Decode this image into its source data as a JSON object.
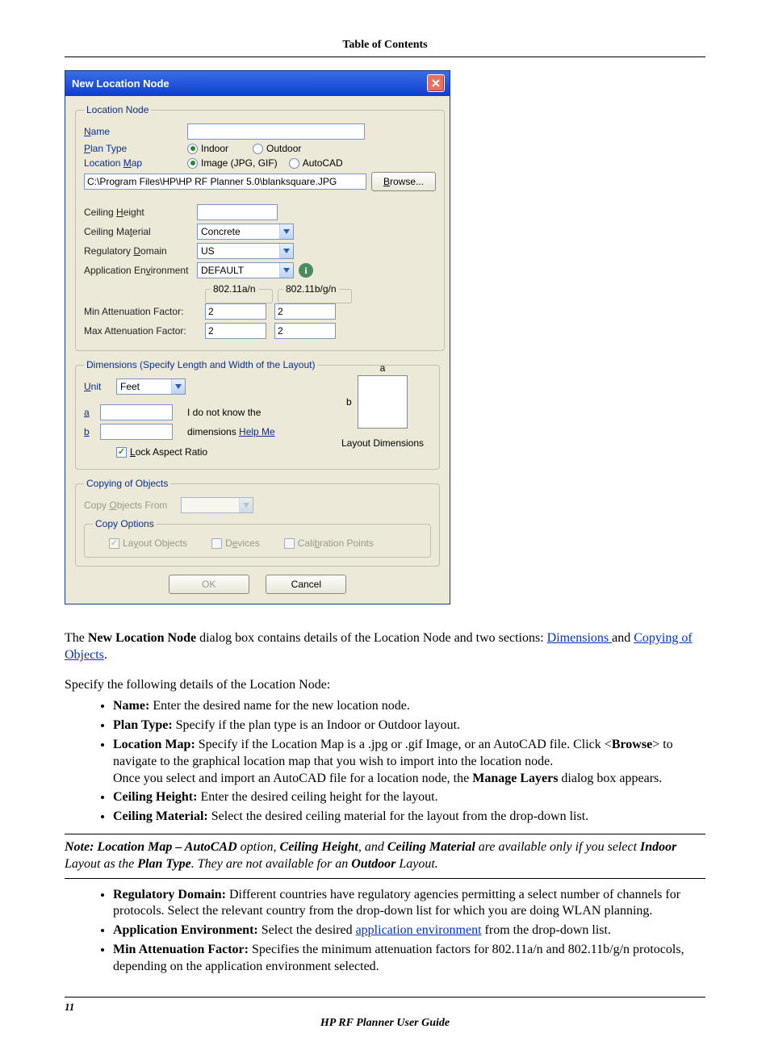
{
  "page": {
    "toc_header": "Table of Contents",
    "page_number": "11",
    "guide_name": "HP RF Planner User Guide"
  },
  "dialog": {
    "title": "New Location Node",
    "groups": {
      "location_node": {
        "legend": "Location Node",
        "name_label": "Name",
        "name_value": "",
        "plan_type_label": "Plan Type",
        "plan_indoor": "Indoor",
        "plan_outdoor": "Outdoor",
        "location_map_label": "Location Map",
        "map_image": "Image (JPG, GIF)",
        "map_autocad": "AutoCAD",
        "path_value": "C:\\Program Files\\HP\\HP RF Planner 5.0\\blanksquare.JPG",
        "browse": "Browse...",
        "ceiling_height": "Ceiling Height",
        "ceiling_height_value": "",
        "ceiling_material": "Ceiling Material",
        "ceiling_material_value": "Concrete",
        "regulatory_domain": "Regulatory Domain",
        "regulatory_domain_value": "US",
        "application_env": "Application Environment",
        "application_env_value": "DEFAULT",
        "proto_a": "802.11a/n",
        "proto_b": "802.11b/g/n",
        "min_att": "Min Attenuation Factor:",
        "max_att": "Max Attenuation Factor:",
        "att_a_min": "2",
        "att_a_max": "2",
        "att_b_min": "2",
        "att_b_max": "2"
      },
      "dimensions": {
        "legend": "Dimensions (Specify Length and Width of the Layout)",
        "unit_label": "Unit",
        "unit_value": "Feet",
        "a_label": "a",
        "a_value": "",
        "b_label": "b",
        "b_value": "",
        "helper1": "I do not know the",
        "helper2_pre": "dimensions ",
        "helper2_link": "Help Me",
        "lock_aspect": "Lock Aspect Ratio",
        "layout_a": "a",
        "layout_b": "b",
        "layout_caption": "Layout Dimensions"
      },
      "copying": {
        "legend": "Copying of Objects",
        "copy_from_label": "Copy Objects From",
        "copy_from_value": "",
        "options_legend": "Copy Options",
        "layout_objects": "Layout Objects",
        "devices": "Devices",
        "calibration_points": "Calibration Points"
      }
    },
    "ok": "OK",
    "cancel": "Cancel"
  },
  "doc": {
    "intro_pre": "The ",
    "intro_bold": "New Location Node",
    "intro_mid": " dialog box contains details of the Location Node and two sections: ",
    "link_dimensions": "Dimensions ",
    "intro_and": "and ",
    "link_copying": "Copying of Objects",
    "intro_period": ".",
    "specify": "Specify the following details of the Location Node:",
    "bullets1": [
      {
        "b": "Name:",
        "t": " Enter the desired name for the new location node."
      },
      {
        "b": "Plan Type:",
        "t": " Specify if the plan type is an Indoor or Outdoor layout."
      },
      {
        "b": "Location Map:",
        "t": " Specify if the Location Map is a .jpg or .gif Image, or an AutoCAD file. Click <",
        "b2": "Browse",
        "t2": "> to navigate to the graphical location map that you wish to import into the location node.",
        "extra": "Once you select and import an AutoCAD file for a location node, the ",
        "extra_b": "Manage Layers",
        "extra_t": " dialog box appears."
      },
      {
        "b": "Ceiling Height:",
        "t": " Enter the desired ceiling height for the layout."
      },
      {
        "b": "Ceiling Material:",
        "t": " Select the desired ceiling material for the layout from the drop-down list."
      }
    ],
    "note_pre": "Note: Location Map – AutoCAD",
    "note_mid1": " option, ",
    "note_b2": "Ceiling Height",
    "note_mid2": ", and ",
    "note_b3": "Ceiling Material",
    "note_mid3": " are available only if you select ",
    "note_b4": "Indoor",
    "note_mid4": " Layout as the ",
    "note_b5": "Plan Type",
    "note_mid5": ". They are not available for an ",
    "note_b6": "Outdoor",
    "note_end": " Layout.",
    "bullets2": [
      {
        "b": "Regulatory Domain:",
        "t": " Different countries have regulatory agencies permitting a select number of channels for protocols. Select the relevant country from the drop-down list for which you are doing WLAN planning."
      },
      {
        "b": "Application Environment:",
        "t": " Select the desired ",
        "link": "application environment",
        "t2": " from the drop-down list."
      },
      {
        "b": "Min Attenuation Factor:",
        "t": " Specifies the minimum attenuation factors for 802.11a/n and 802.11b/g/n protocols, depending on the application environment selected."
      }
    ]
  }
}
